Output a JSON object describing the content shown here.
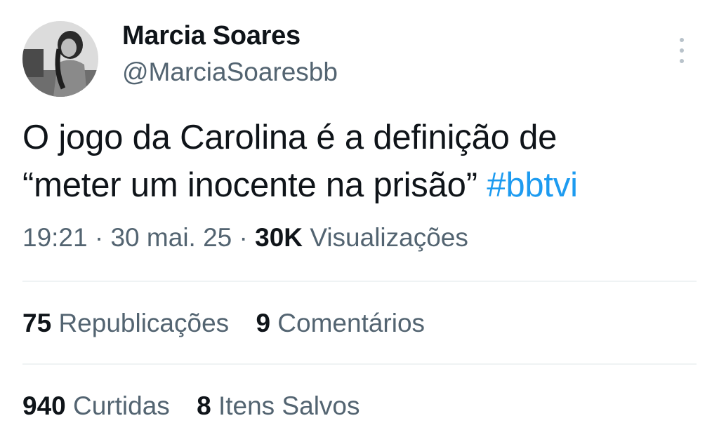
{
  "author": {
    "display_name": "Marcia Soares",
    "handle": "@MarciaSoaresbb",
    "avatar_icon": "profile-photo"
  },
  "more_icon": "vertical-ellipsis-icon",
  "tweet": {
    "line1": "O jogo da Carolina é a definição de",
    "line2": "“meter um inocente na prisão”",
    "hashtag": "#bbtvi"
  },
  "meta": {
    "time": "19:21",
    "separator": "·",
    "date": "30 mai. 25",
    "views_count": "30K",
    "views_label": "Visualizações"
  },
  "stats_row1": {
    "reposts_count": "75",
    "reposts_label": "Republicações",
    "comments_count": "9",
    "comments_label": "Comentários"
  },
  "stats_row2": {
    "likes_count": "940",
    "likes_label": "Curtidas",
    "bookmarks_count": "8",
    "bookmarks_label": "Itens Salvos"
  },
  "colors": {
    "text": "#0f1419",
    "secondary": "#536471",
    "accent": "#1d9bf0",
    "divider": "#eff3f4"
  }
}
